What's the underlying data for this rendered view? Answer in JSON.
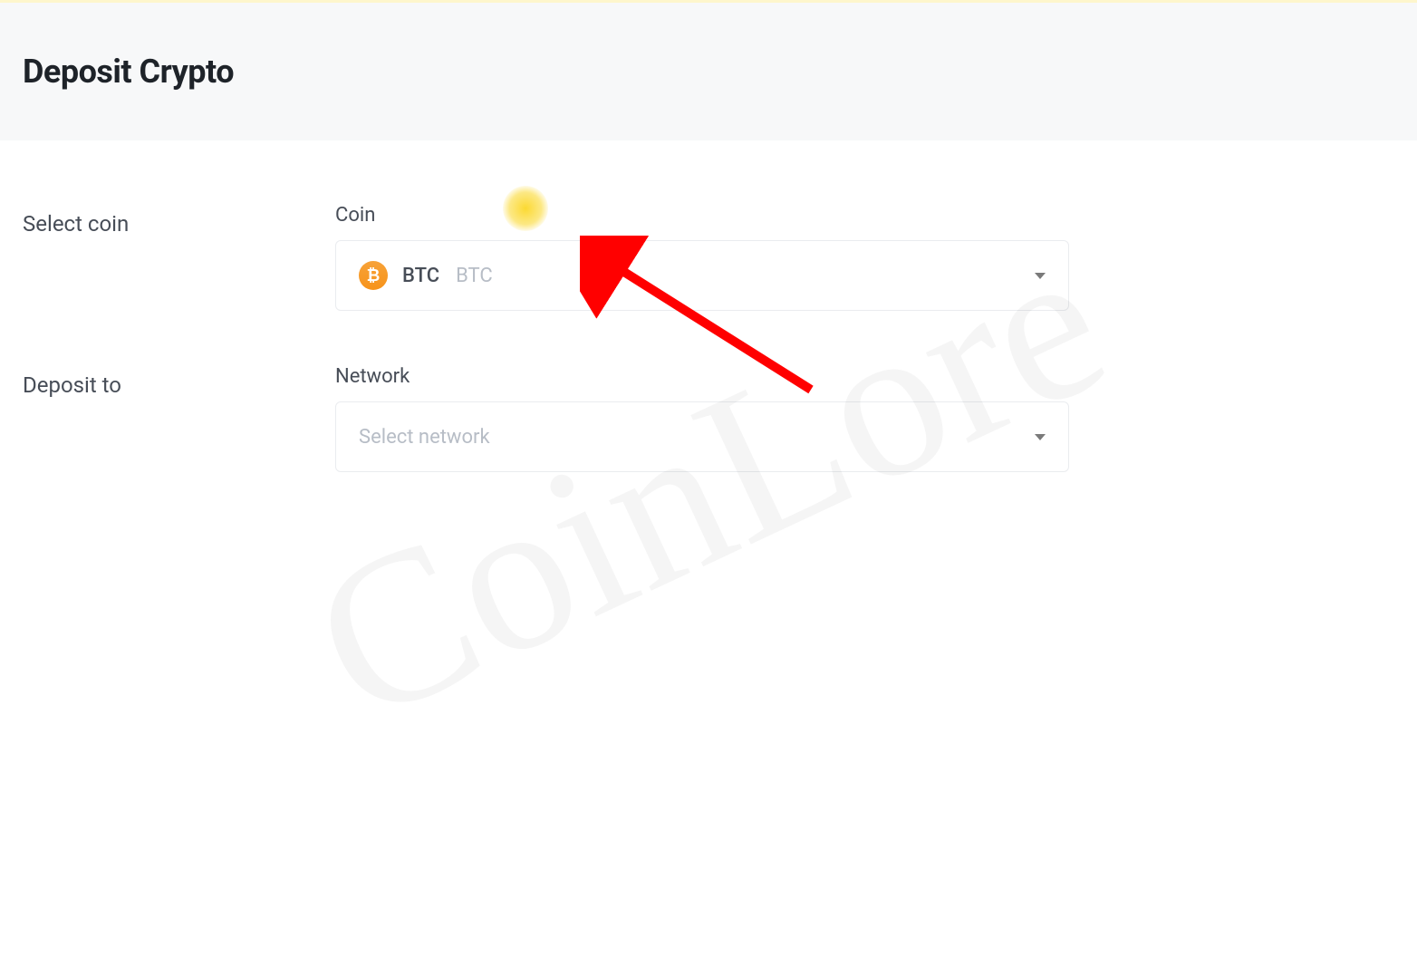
{
  "header": {
    "title": "Deposit Crypto"
  },
  "form": {
    "select_coin": {
      "label": "Select coin",
      "field_label": "Coin",
      "selected": {
        "icon_text": "₿",
        "symbol": "BTC",
        "name": "BTC"
      }
    },
    "deposit_to": {
      "label": "Deposit to",
      "field_label": "Network",
      "placeholder": "Select network"
    }
  },
  "watermark": "CoinLore"
}
